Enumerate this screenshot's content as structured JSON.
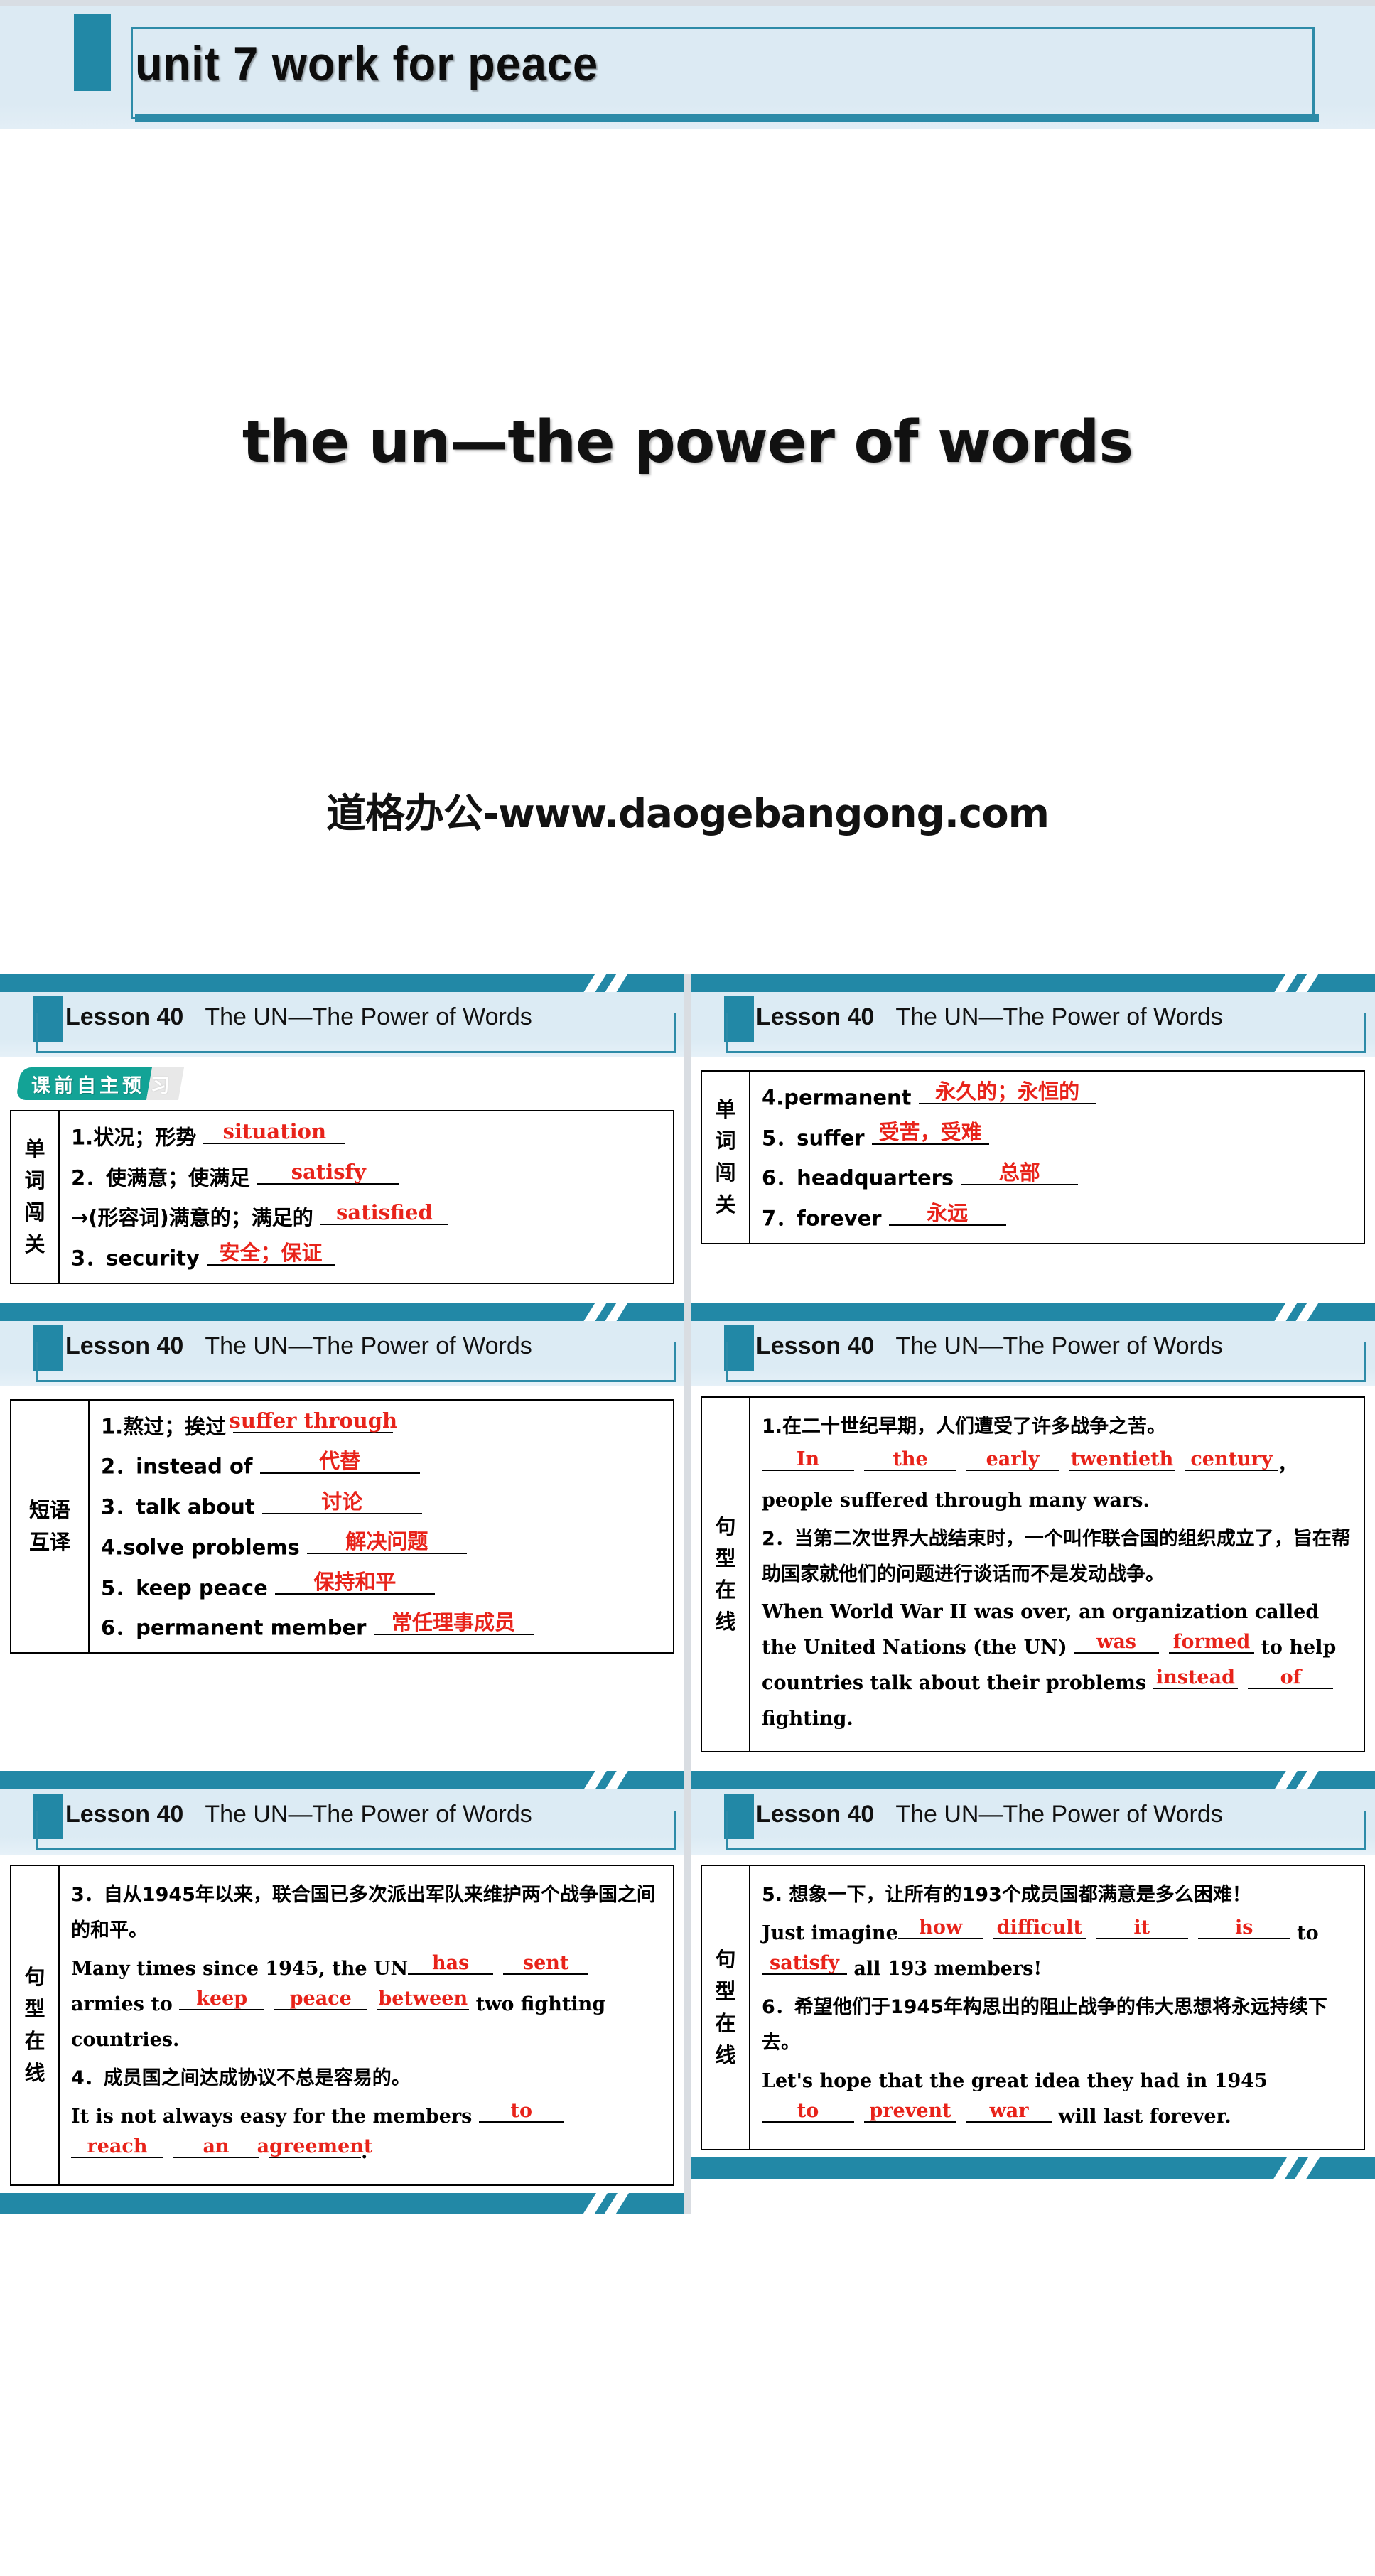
{
  "cover": {
    "unit_title": "unit 7   work  for  peace",
    "main_title": "the un—the power of words",
    "watermark": "道格办公-www.daogebangong.com",
    "accent_color": "#2288a6",
    "band_color": "#dceaf3"
  },
  "slide_header": {
    "lesson": "Lesson 40",
    "topic": "The UN—The Power of Words"
  },
  "badge": {
    "main": "课前自主预习",
    "visible_text": "课前自主预习",
    "head": "课前自主预",
    "tail": "习",
    "color": "#13a396"
  },
  "slides": [
    {
      "id": "slide-1",
      "label": "单词闯关",
      "label_chars": [
        "单",
        "词",
        "闯",
        "关"
      ],
      "rows": [
        {
          "prompt": "1.状况；形势",
          "answer": "situation",
          "answer_lang": "en",
          "blank_width": "w200"
        },
        {
          "prompt": "2．使满意；使满足",
          "answer": "satisfy",
          "answer_lang": "en",
          "blank_width": "w200"
        },
        {
          "prompt": "→(形容词)满意的；满足的",
          "answer": "satisfied",
          "answer_lang": "en",
          "blank_width": "w180"
        },
        {
          "prompt": "3．security",
          "answer": "安全；保证",
          "answer_lang": "cn",
          "blank_width": "w180"
        }
      ]
    },
    {
      "id": "slide-2",
      "label": "单词闯关",
      "label_chars": [
        "单",
        "词",
        "闯",
        "关"
      ],
      "rows": [
        {
          "prompt": "4.permanent",
          "answer": "永久的；永恒的",
          "answer_lang": "cn",
          "blank_width": "w250"
        },
        {
          "prompt": "5．suffer",
          "answer": "受苦，受难",
          "answer_lang": "cn",
          "blank_width": "w165"
        },
        {
          "prompt": "6．headquarters",
          "answer": "总部",
          "answer_lang": "cn",
          "blank_width": "w165"
        },
        {
          "prompt": "7．forever",
          "answer": "永远",
          "answer_lang": "cn",
          "blank_width": "w165"
        }
      ]
    },
    {
      "id": "slide-3",
      "label": "短语互译",
      "label_chars": [
        "短语",
        "互译"
      ],
      "rows": [
        {
          "prompt": "1.熬过；挨过",
          "answer": "suffer through",
          "answer_lang": "en",
          "blank_width": "w225"
        },
        {
          "prompt": "2．instead of",
          "answer": "代替",
          "answer_lang": "cn",
          "blank_width": "w225"
        },
        {
          "prompt": "3．talk about",
          "answer": "讨论",
          "answer_lang": "cn",
          "blank_width": "w225"
        },
        {
          "prompt": "4.solve problems",
          "answer": "解决问题",
          "answer_lang": "cn",
          "blank_width": "w225"
        },
        {
          "prompt": "5．keep peace",
          "answer": "保持和平",
          "answer_lang": "cn",
          "blank_width": "w225"
        },
        {
          "prompt": "6．permanent member",
          "answer": "常任理事成员",
          "answer_lang": "cn",
          "blank_width": "w225"
        }
      ]
    },
    {
      "id": "slide-4",
      "label": "句型在线",
      "label_chars": [
        "句",
        "型",
        "在",
        "线"
      ],
      "items": [
        {
          "cn": "1.在二十世纪早期，人们遭受了许多战争之苦。",
          "en_parts": [
            {
              "t": "blank",
              "v": "In",
              "w": "w130"
            },
            {
              "t": "gap"
            },
            {
              "t": "blank",
              "v": "the",
              "w": "w130"
            },
            {
              "t": "gap"
            },
            {
              "t": "blank",
              "v": "early",
              "w": "w130"
            },
            {
              "t": "gap"
            },
            {
              "t": "blank",
              "v": "twentieth",
              "w": "w150"
            },
            {
              "t": "gap"
            },
            {
              "t": "blank",
              "v": "century",
              "w": "w130"
            },
            {
              "t": "text",
              "v": "，people suffered through many wars."
            }
          ]
        },
        {
          "cn": "2．当第二次世界大战结束时，一个叫作联合国的组织成立了，旨在帮助国家就他们的问题进行谈话而不是发动战争。",
          "en_parts": [
            {
              "t": "text",
              "v": "When World War II was over, an organization called the United Nations (the UN) "
            },
            {
              "t": "blank",
              "v": "was",
              "w": "w120"
            },
            {
              "t": "gap"
            },
            {
              "t": "blank",
              "v": "formed",
              "w": "w120"
            },
            {
              "t": "text",
              "v": " to help countries talk about their problems "
            },
            {
              "t": "blank",
              "v": "instead",
              "w": "w120"
            },
            {
              "t": "gap"
            },
            {
              "t": "blank",
              "v": "of",
              "w": "w120"
            },
            {
              "t": "text",
              "v": " fighting."
            }
          ]
        }
      ]
    },
    {
      "id": "slide-5",
      "label": "句型在线",
      "label_chars": [
        "句",
        "型",
        "在",
        "线"
      ],
      "items": [
        {
          "cn": "3．自从1945年以来，联合国已多次派出军队来维护两个战争国之间的和平。",
          "en_parts": [
            {
              "t": "text",
              "v": "Many times since 1945, the UN"
            },
            {
              "t": "blank",
              "v": "has",
              "w": "w120"
            },
            {
              "t": "gap"
            },
            {
              "t": "blank",
              "v": "sent",
              "w": "w120"
            },
            {
              "t": "text",
              "v": " armies to "
            },
            {
              "t": "blank",
              "v": "keep",
              "w": "w120"
            },
            {
              "t": "gap"
            },
            {
              "t": "blank",
              "v": "peace",
              "w": "w130"
            },
            {
              "t": "gap"
            },
            {
              "t": "blank",
              "v": "between",
              "w": "w130"
            },
            {
              "t": "text",
              "v": " two fighting countries."
            }
          ]
        },
        {
          "cn": "4．成员国之间达成协议不总是容易的。",
          "en_parts": [
            {
              "t": "text",
              "v": "It is not always easy for the members "
            },
            {
              "t": "blank",
              "v": "to",
              "w": "w120"
            },
            {
              "t": "gap"
            },
            {
              "t": "blank",
              "v": "reach",
              "w": "w130"
            },
            {
              "t": "gap"
            },
            {
              "t": "blank",
              "v": "an",
              "w": "w120"
            },
            {
              "t": "gap"
            },
            {
              "t": "blank",
              "v": "agreement",
              "w": "w130"
            },
            {
              "t": "text",
              "v": "."
            }
          ]
        }
      ]
    },
    {
      "id": "slide-6",
      "label": "句型在线",
      "label_chars": [
        "句",
        "型",
        "在",
        "线"
      ],
      "items": [
        {
          "cn": "5. 想象一下，让所有的193个成员国都满意是多么困难！",
          "en_parts": [
            {
              "t": "text",
              "v": "Just imagine"
            },
            {
              "t": "blank",
              "v": "how",
              "w": "w120"
            },
            {
              "t": "gap"
            },
            {
              "t": "blank",
              "v": "difficult",
              "w": "w130"
            },
            {
              "t": "gap"
            },
            {
              "t": "blank",
              "v": "it",
              "w": "w130"
            },
            {
              "t": "gap"
            },
            {
              "t": "blank",
              "v": "is",
              "w": "w130"
            },
            {
              "t": "text",
              "v": " to "
            },
            {
              "t": "blank",
              "v": "satisfy",
              "w": "w120"
            },
            {
              "t": "text",
              "v": " all 193 members!"
            }
          ]
        },
        {
          "cn": "6．希望他们于1945年构思出的阻止战争的伟大思想将永远持续下去。",
          "en_parts": [
            {
              "t": "text",
              "v": "Let's hope that the great idea they had in 1945 "
            },
            {
              "t": "blank",
              "v": "to",
              "w": "w130"
            },
            {
              "t": "gap"
            },
            {
              "t": "blank",
              "v": "prevent",
              "w": "w130"
            },
            {
              "t": "gap"
            },
            {
              "t": "blank",
              "v": "war",
              "w": "w120"
            },
            {
              "t": "text",
              "v": " will last forever."
            }
          ]
        }
      ]
    }
  ]
}
